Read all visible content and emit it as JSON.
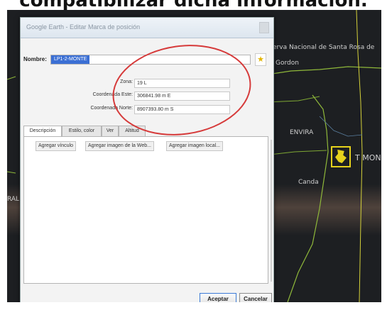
{
  "caption": "compatibilizar dicha información.",
  "dialog": {
    "title": "Google Earth - Editar Marca de posición",
    "name_label": "Nombre:",
    "name_value": "LP1-2-MONTE",
    "zone_label": "Zona:",
    "zone_value": "19 L",
    "easting_label": "Coordenada Este:",
    "easting_value": "306841.98 m E",
    "northing_label": "Coordenada Norte:",
    "northing_value": "8907393.80 m S",
    "tabs": [
      "Descripción",
      "Estilo, color",
      "Ver",
      "Altitud"
    ],
    "add_buttons": [
      "Agregar vínculo",
      "Agregar imagen de la Web...",
      "Agregar imagen local..."
    ],
    "ok_label": "Aceptar",
    "cancel_label": "Cancelar"
  },
  "map": {
    "labels": {
      "reserve": "erva Nacional de Santa Rosa de",
      "reserve_sub": "Gordon",
      "right_edge": "T MON",
      "town": "Canda",
      "left_edge": "ENVIRA",
      "left_bottom": "RAL"
    }
  },
  "colors": {
    "highlight_ellipse": "#d63a3a",
    "placemark": "#e6d21c",
    "selection": "#3b6fd4"
  }
}
